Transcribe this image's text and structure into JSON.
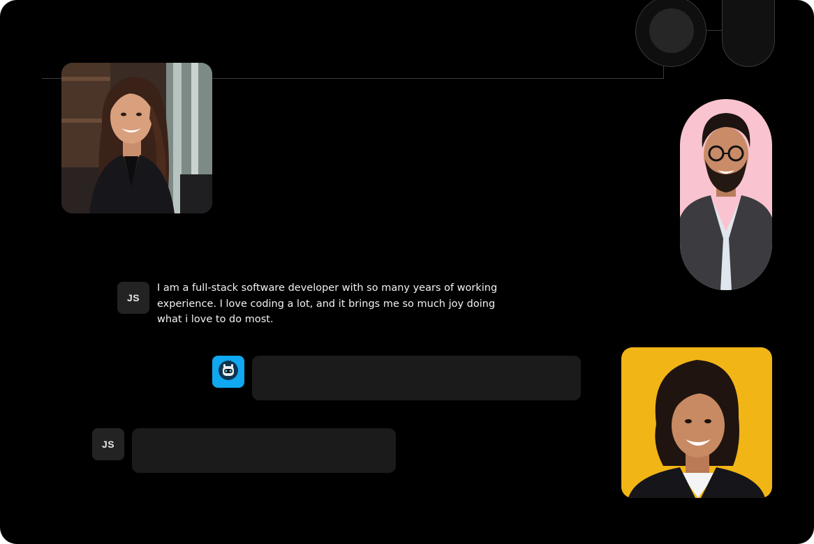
{
  "colors": {
    "background": "#000000",
    "bubble": "#1b1b1b",
    "avatar": "#232323",
    "bot_accent": "#10a8f0",
    "photo_pink": "#f9c4cf",
    "photo_yellow": "#f2b516"
  },
  "chat": {
    "user_initials": "JS",
    "user_message": "I am a full-stack software developer with so many years of working experience. I love coding a lot, and it brings me so much joy doing what i love to do most.",
    "bot_icon": "robot-icon"
  },
  "photos": [
    {
      "name": "woman-office-portrait"
    },
    {
      "name": "man-glasses-portrait"
    },
    {
      "name": "woman-yellow-portrait"
    }
  ]
}
